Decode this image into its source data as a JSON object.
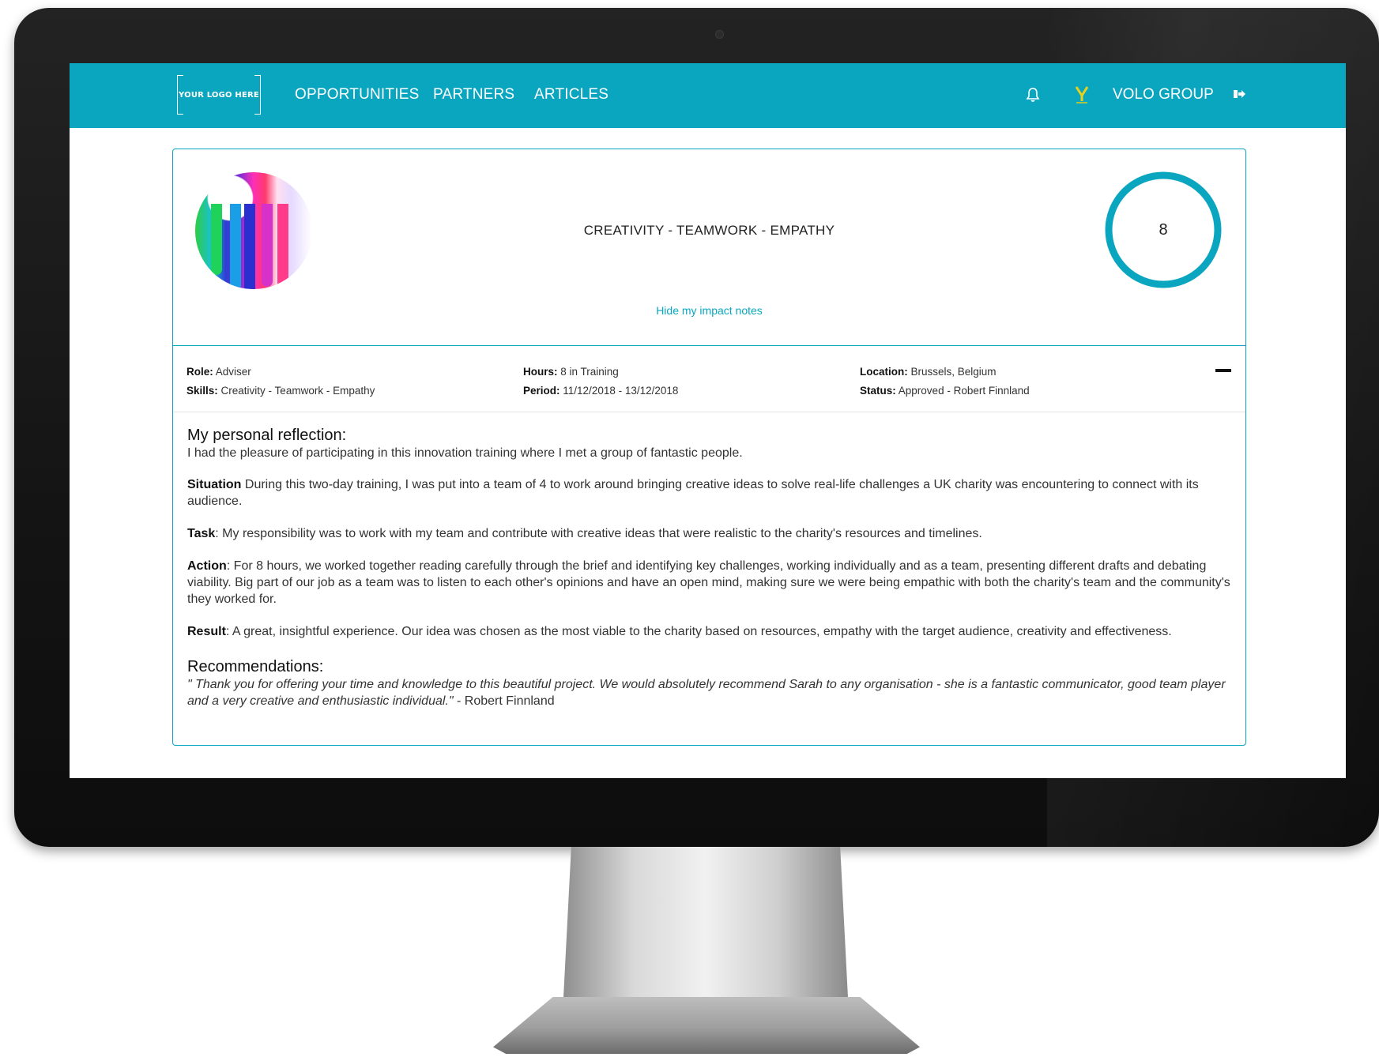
{
  "navbar": {
    "logo_text": "YOUR LOGO HERE",
    "links": [
      "OPPORTUNITIES",
      "PARTNERS",
      "ARTICLES"
    ],
    "org_name": "VOLO GROUP",
    "accent_color": "#0aa6bf"
  },
  "card": {
    "skills_title": "CREATIVITY - TEAMWORK - EMPATHY",
    "hours_total": "8",
    "toggle_label": "Hide my impact notes",
    "meta": {
      "role_label": "Role:",
      "role_value": "Adviser",
      "skills_label": "Skills:",
      "skills_value": "Creativity - Teamwork - Empathy",
      "hours_label": "Hours:",
      "hours_value": "8 in Training",
      "period_label": "Period:",
      "period_value": "11/12/2018 - 13/12/2018",
      "location_label": "Location:",
      "location_value": "Brussels, Belgium",
      "status_label": "Status:",
      "status_value": "Approved  - Robert Finnland"
    },
    "reflection": {
      "heading": "My personal reflection:",
      "intro": "I had the pleasure of participating in this innovation training where I met a group of fantastic people.",
      "situation_label": "Situation",
      "situation_text": " During this two-day training, I was put into a team of 4 to work around bringing creative ideas to solve real-life challenges a UK charity was encountering to connect with its audience.",
      "task_label": "Task",
      "task_text": ": My responsibility was to work with my team and contribute with creative ideas that were realistic to the charity's resources and timelines.",
      "action_label": "Action",
      "action_text": ": For 8 hours, we worked together reading carefully through the brief and identifying key challenges, working individually and as a team, presenting different drafts and debating viability. Big part of our job as a team was to listen to each other's opinions and have an open mind, making sure we were being empathic with both the charity's team and the community's they worked for.",
      "result_label": "Result",
      "result_text": ": A great, insightful experience. Our idea was chosen as the most viable to the charity based on resources, empathy with the target audience, creativity and effectiveness."
    },
    "recommendations": {
      "heading": "Recommendations:",
      "quote": "\" Thank you for offering your time and knowledge to this beautiful project. We would absolutely recommend Sarah to any organisation - she is a fantastic communicator, good team player and a very creative and enthusiastic individual.\"",
      "author": " - Robert Finnland"
    }
  }
}
